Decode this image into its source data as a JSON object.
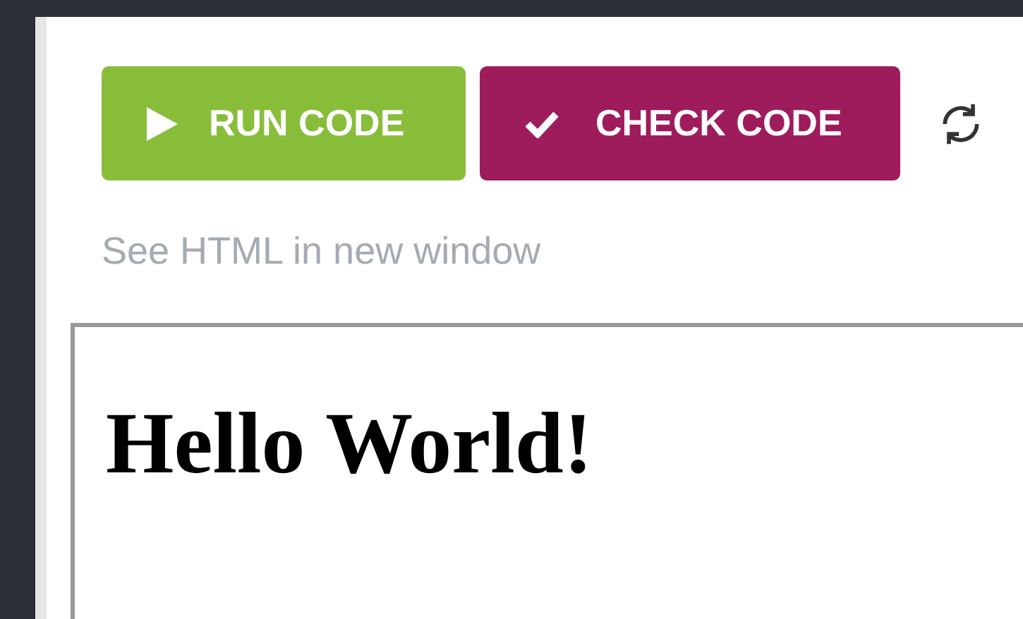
{
  "toolbar": {
    "run_button": "RUN CODE",
    "check_button": "CHECK CODE"
  },
  "link": "See HTML in new window",
  "preview": {
    "heading": "Hello World!"
  }
}
